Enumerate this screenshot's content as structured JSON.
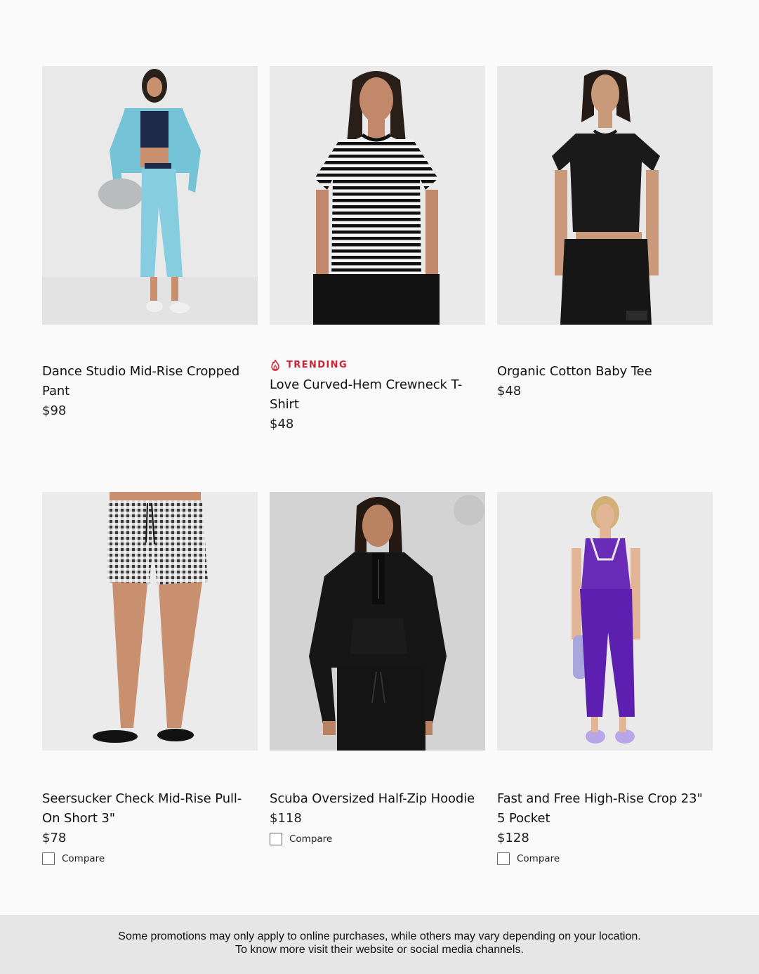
{
  "products_row1": [
    {
      "name": "Dance Studio Mid-Rise Cropped Pant",
      "price": "$98",
      "trending": false
    },
    {
      "name": "Love Curved-Hem Crewneck T-Shirt",
      "price": "$48",
      "trending": true,
      "badge": "TRENDING"
    },
    {
      "name": "Organic Cotton Baby Tee",
      "price": "$48",
      "trending": false
    }
  ],
  "products_row2": [
    {
      "name": "Seersucker Check Mid-Rise Pull-On Short 3\"",
      "price": "$78",
      "compare_label": "Compare"
    },
    {
      "name": "Scuba Oversized Half-Zip Hoodie",
      "price": "$118",
      "compare_label": "Compare"
    },
    {
      "name": "Fast and Free High-Rise Crop 23\" 5 Pocket",
      "price": "$128",
      "compare_label": "Compare"
    }
  ],
  "footer": {
    "line1": "Some promotions may only apply to online purchases, while others may vary depending on your location.",
    "line2": "To know more visit their website or social media channels."
  },
  "colors": {
    "accent_trending": "#d31f32",
    "footer_bg": "#e6e6e6",
    "page_bg": "#fafafa"
  }
}
